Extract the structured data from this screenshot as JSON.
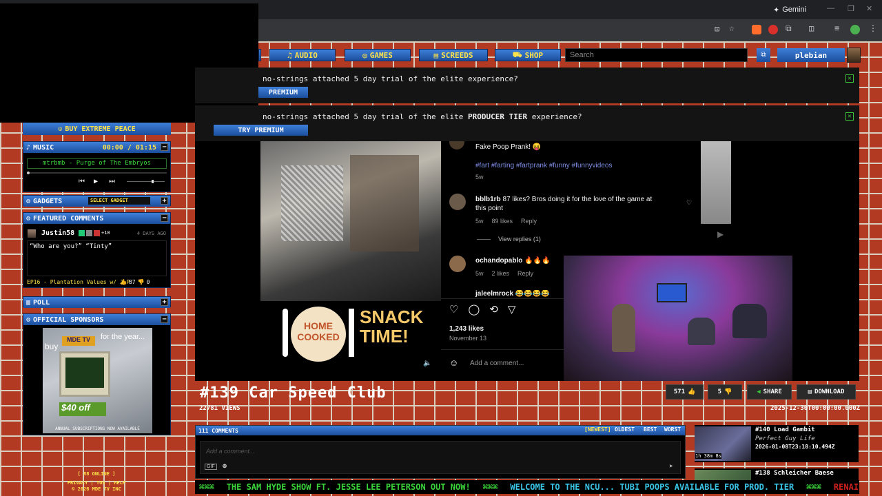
{
  "browser": {
    "gemini_label": "Gemini",
    "ext_colors": [
      "#ff6d2d",
      "#d9302c",
      "#9aa0a6",
      "#9aa0a6",
      "#4caf50"
    ]
  },
  "nav": {
    "items": [
      {
        "label": "AUDIO",
        "icon": "music-note-icon",
        "glyph": "♫"
      },
      {
        "label": "GAMES",
        "icon": "gamepad-icon",
        "glyph": "◎"
      },
      {
        "label": "SCREEDS",
        "icon": "document-icon",
        "glyph": "▤"
      },
      {
        "label": "SHOP",
        "icon": "cart-icon",
        "glyph": "⛟"
      }
    ],
    "search_placeholder": "Search",
    "username": "plebian"
  },
  "banners": [
    {
      "text": "no-strings attached 5 day trial of the elite experience?",
      "button": "PREMIUM"
    },
    {
      "text_pre": "no-strings attached 5 day trial of the elite ",
      "text_bold": "PRODUCER TIER",
      "text_post": " experience?",
      "button": "TRY PREMIUM"
    }
  ],
  "sidebar": {
    "buy_label": "BUY EXTREME PEACE",
    "music": {
      "title": "MUSIC",
      "time": "00:00 / 01:15",
      "track": "mtrbmb - Purge of The Embryos",
      "progress": 0.0,
      "volume": 0.7
    },
    "gadgets": {
      "title": "GADGETS",
      "select_label": "SELECT GADGET"
    },
    "featured": {
      "title": "FEATURED COMMENTS",
      "user": "Justin58",
      "badge_extra": "+10",
      "time_ago": "4 DAYS AGO",
      "text": "“Who are you?” “Tinty”",
      "episode": "EP16 - Plantation Values w/ JLP",
      "likes": "87",
      "dislikes": "0"
    },
    "poll": {
      "title": "POLL"
    },
    "sponsors": {
      "title": "OFFICIAL SPONSORS",
      "ad_buy": "buy",
      "ad_brand": "MDE TV",
      "ad_for": "for the year...",
      "ad_off": "$40 off",
      "ad_caption": "ANNUAL SUBSCRIPTIONS NOW AVAILABLE"
    },
    "footer": {
      "online": "[ 88 ONLINE ]",
      "links": "PRIVACY | TOS | HELP",
      "copyright": "© 2026 MDE TV INC"
    }
  },
  "video": {
    "overlay": {
      "caption_title": "Fake Poop Prank! 😝",
      "hashtags": "#fart #farting #fartprank #funny #funnyvideos",
      "caption_age": "5w",
      "comments": [
        {
          "user": "bblb1rb",
          "text": "87 likes? Bros doing it for the love of the game at this point",
          "age": "5w",
          "likes": "89 likes",
          "reply": "Reply",
          "view_replies": "View replies (1)"
        },
        {
          "user": "ochandopablo",
          "text": "🔥🔥🔥",
          "age": "5w",
          "likes": "2 likes",
          "reply": "Reply"
        },
        {
          "user": "jaleelmrock",
          "text": "😂😂😂😂"
        }
      ],
      "likes_count": "1,243 likes",
      "post_date": "November 13",
      "add_comment": "Add a comment...",
      "snack_left": "HOME COOKED",
      "snack_right": "SNACK TIME!"
    },
    "title": "#139 Car Speed Club",
    "views": "22781 VIEWS",
    "likes": "571",
    "dislikes": "5",
    "share_label": "SHARE",
    "download_label": "DOWNLOAD",
    "date": "2025-12-30T00:00:00.000Z"
  },
  "comments": {
    "count_label": "111 COMMENTS",
    "sort": [
      "[NEWEST]",
      "OLDEST",
      "BEST",
      "WORST"
    ],
    "placeholder": "Add a comment...",
    "gif_label": "GIF"
  },
  "related": [
    {
      "title": "#140 Load Gambit",
      "subtitle": "Perfect Guy Life",
      "date": "2026-01-08T23:18:10.494Z",
      "duration": "1h 38m 8s"
    },
    {
      "title": "#138 Schleicher Baese",
      "subtitle": "",
      "date": "",
      "duration": ""
    }
  ],
  "ticker": [
    "⌘⌘⌘",
    "THE SAM HYDE SHOW FT. JESSE LEE PETERSON OUT NOW!",
    "⌘⌘⌘",
    "WELCOME TO THE NCU... TUBI POOPS AVAILABLE FOR PROD. TIER",
    "⌘⌘⌘",
    "RENAISSAN"
  ]
}
